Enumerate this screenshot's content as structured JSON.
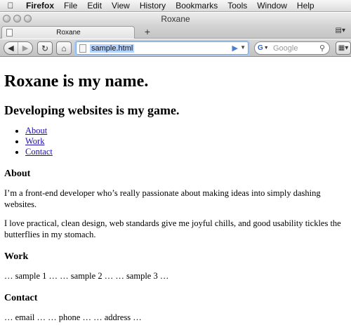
{
  "menubar": {
    "app": "Firefox",
    "items": [
      "File",
      "Edit",
      "View",
      "History",
      "Bookmarks",
      "Tools",
      "Window",
      "Help"
    ]
  },
  "window": {
    "title": "Roxane"
  },
  "tabs": [
    {
      "label": "Roxane",
      "active": true
    }
  ],
  "toolbar": {
    "new_tab_glyph": "+",
    "url": "sample.html",
    "search_placeholder": "Google",
    "search_engine_glyph": "G"
  },
  "page": {
    "h1": "Roxane is my name.",
    "h2": "Developing websites is my game.",
    "nav": [
      "About",
      "Work",
      "Contact"
    ],
    "about_heading": "About",
    "about_p1": "I’m a front-end developer who’s really passionate about making ideas into simply dashing websites.",
    "about_p2": "I love practical, clean design, web standards give me joyful chills, and good usability tickles the butterflies in my stomach.",
    "work_heading": "Work",
    "work_text": "… sample 1 … … sample 2 … … sample 3 …",
    "contact_heading": "Contact",
    "contact_text": "… email … … phone … … address …"
  },
  "colors": {
    "link": "#1a0dab",
    "url_highlight": "#b5d3ff",
    "focus_ring": "#a9c9f2"
  }
}
